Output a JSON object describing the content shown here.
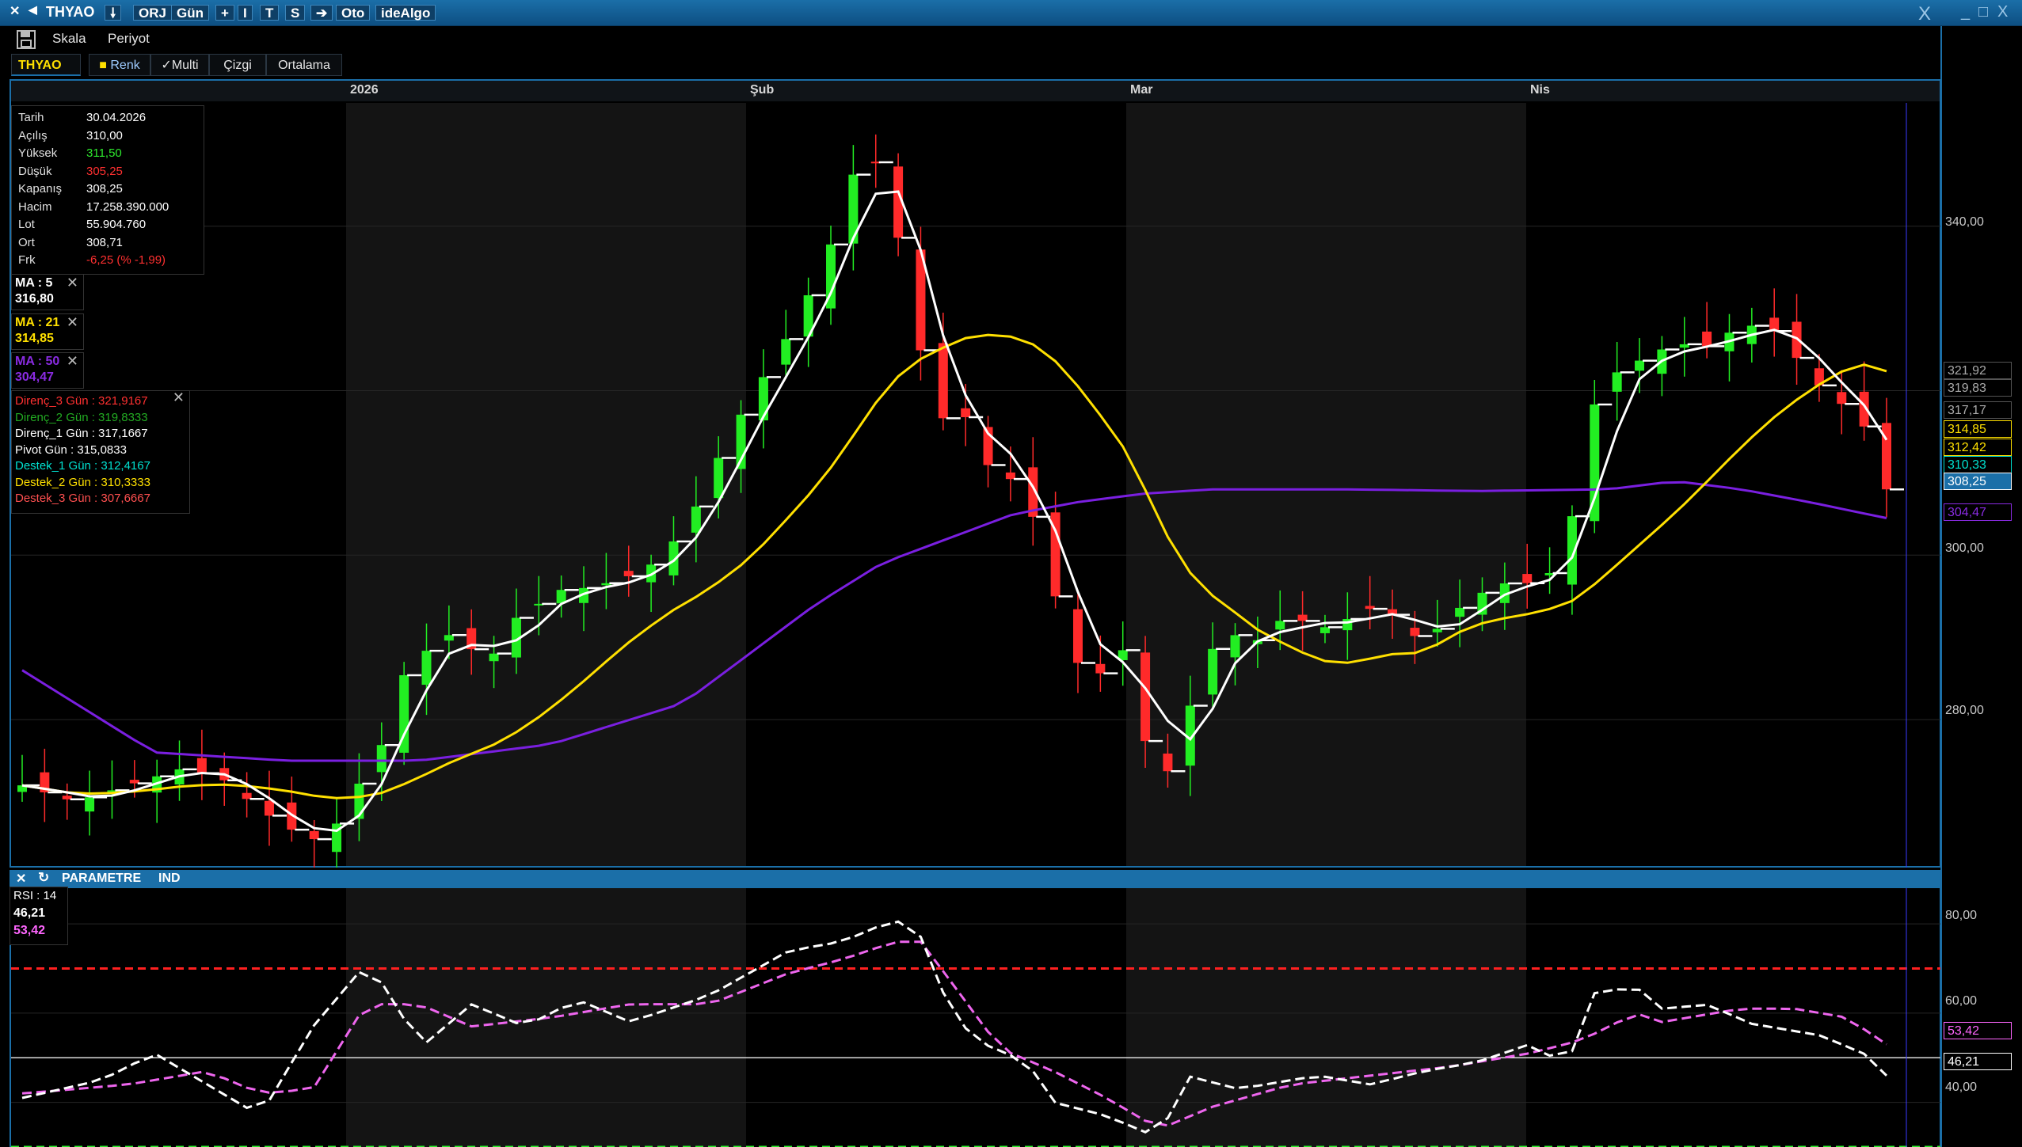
{
  "titlebar": {
    "symbol": "THYAO",
    "orj": "ORJ",
    "period": "Gün",
    "plus": "+",
    "i_btn": "I",
    "t_btn": "T",
    "s_btn": "S",
    "arrow": "➔",
    "oto": "Oto",
    "idealgo": "ideAlgo",
    "close": "X",
    "min": "_",
    "max": "□",
    "close2": "X"
  },
  "toolbar": {
    "skala": "Skala",
    "periyot": "Periyot"
  },
  "tabs": {
    "symbol": "THYAO",
    "renk": "Renk",
    "multi": "Multi",
    "cizgi": "Çizgi",
    "ortalama": "Ortalama"
  },
  "months": [
    "2026",
    "Şub",
    "Mar",
    "Nis"
  ],
  "price_ticks": [
    "340,00",
    "300,00",
    "280,00"
  ],
  "info": [
    {
      "k": "Tarih",
      "v": "30.04.2026",
      "c": "#ffffff"
    },
    {
      "k": "Açılış",
      "v": "310,00",
      "c": "#ffffff"
    },
    {
      "k": "Yüksek",
      "v": "311,50",
      "c": "#2ee82e"
    },
    {
      "k": "Düşük",
      "v": "305,25",
      "c": "#ff3030"
    },
    {
      "k": "Kapanış",
      "v": "308,25",
      "c": "#ffffff"
    },
    {
      "k": "Hacim",
      "v": "17.258.390.000",
      "c": "#ffffff"
    },
    {
      "k": "Lot",
      "v": "55.904.760",
      "c": "#ffffff"
    },
    {
      "k": "Ort",
      "v": "308,71",
      "c": "#ffffff"
    },
    {
      "k": "Frk",
      "v": "-6,25 (% -1,99)",
      "c": "#ff3030"
    }
  ],
  "ma": [
    {
      "label": "MA : 5",
      "value": "316,80",
      "color": "#ffffff"
    },
    {
      "label": "MA : 21",
      "value": "314,85",
      "color": "#ffe000"
    },
    {
      "label": "MA : 50",
      "value": "304,47",
      "color": "#8a2be2"
    }
  ],
  "pivot": [
    {
      "t": "Direnç_3 Gün  :  321,9167",
      "c": "#ff3030"
    },
    {
      "t": "Direnç_2 Gün  :  319,8333",
      "c": "#22aa22"
    },
    {
      "t": "Direnç_1 Gün  :  317,1667",
      "c": "#ffffff"
    },
    {
      "t": "Pivot Gün  :  315,0833",
      "c": "#ffffff"
    },
    {
      "t": "Destek_1 Gün  :  312,4167",
      "c": "#00e0d0"
    },
    {
      "t": "Destek_2 Gün  :  310,3333",
      "c": "#ffe000"
    },
    {
      "t": "Destek_3 Gün  :  307,6667",
      "c": "#ff5050"
    }
  ],
  "price_boxes": [
    {
      "v": "321,92",
      "c": "#aaaaaa",
      "bg": "#000000"
    },
    {
      "v": "319,83",
      "c": "#aaaaaa",
      "bg": "#000000"
    },
    {
      "v": "317,17",
      "c": "#aaaaaa",
      "bg": "#000000"
    },
    {
      "v": "314,85",
      "c": "#ffe000",
      "bg": "#000000"
    },
    {
      "v": "312,42",
      "c": "#ffe000",
      "bg": "#000000"
    },
    {
      "v": "310,33",
      "c": "#00e0d0",
      "bg": "#000000"
    },
    {
      "v": "308,25",
      "c": "#ffffff",
      "bg": "#1b6fa8"
    },
    {
      "v": "304,47",
      "c": "#8a2be2",
      "bg": "#000000"
    }
  ],
  "rsi_panel": {
    "close": "✕",
    "refresh": "↻",
    "param": "PARAMETRE",
    "ind": "IND"
  },
  "rsi_legend": {
    "label": "RSI : 14",
    "v1": "46,21",
    "v2": "53,42"
  },
  "rsi_ticks": [
    "80,00",
    "60,00",
    "40,00"
  ],
  "rsi_boxes": [
    {
      "v": "53,42",
      "c": "#ff66ff"
    },
    {
      "v": "46,21",
      "c": "#ffffff"
    }
  ],
  "chart_data": {
    "type": "line",
    "symbol": "THYAO",
    "candles": [],
    "series": [
      {
        "name": "MA : 5",
        "color": "#ffffff"
      },
      {
        "name": "MA : 21",
        "color": "#ffe000"
      },
      {
        "name": "MA : 50",
        "color": "#8a2be2"
      }
    ],
    "ylim": [
      262,
      355
    ],
    "rsi": {
      "ylim": [
        30,
        88
      ],
      "upper": 70,
      "lower": 30,
      "mid": 50
    }
  }
}
